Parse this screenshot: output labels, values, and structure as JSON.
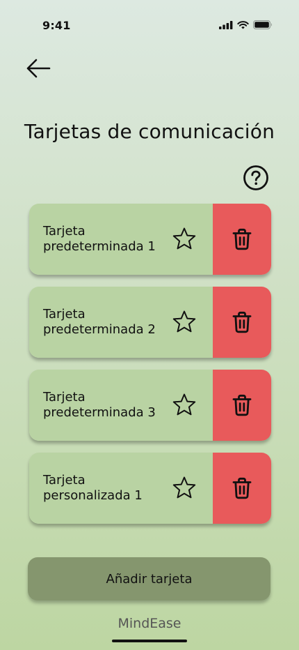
{
  "status_bar": {
    "time": "9:41"
  },
  "header": {
    "title": "Tarjetas de comunicación",
    "back_icon": "arrow-left-icon",
    "help_icon": "question-circle-icon"
  },
  "cards": [
    {
      "label": "Tarjeta predeterminada 1",
      "favorite": false
    },
    {
      "label": "Tarjeta predeterminada 2",
      "favorite": false
    },
    {
      "label": "Tarjeta predeterminada 3",
      "favorite": false
    },
    {
      "label": "Tarjeta personalizada 1",
      "favorite": false
    }
  ],
  "actions": {
    "add_card_label": "Añadir tarjeta"
  },
  "footer": {
    "brand": "MindEase"
  },
  "colors": {
    "card_background": "#b9d3a3",
    "delete_background": "#e85a5b",
    "button_background": "#85966e"
  }
}
